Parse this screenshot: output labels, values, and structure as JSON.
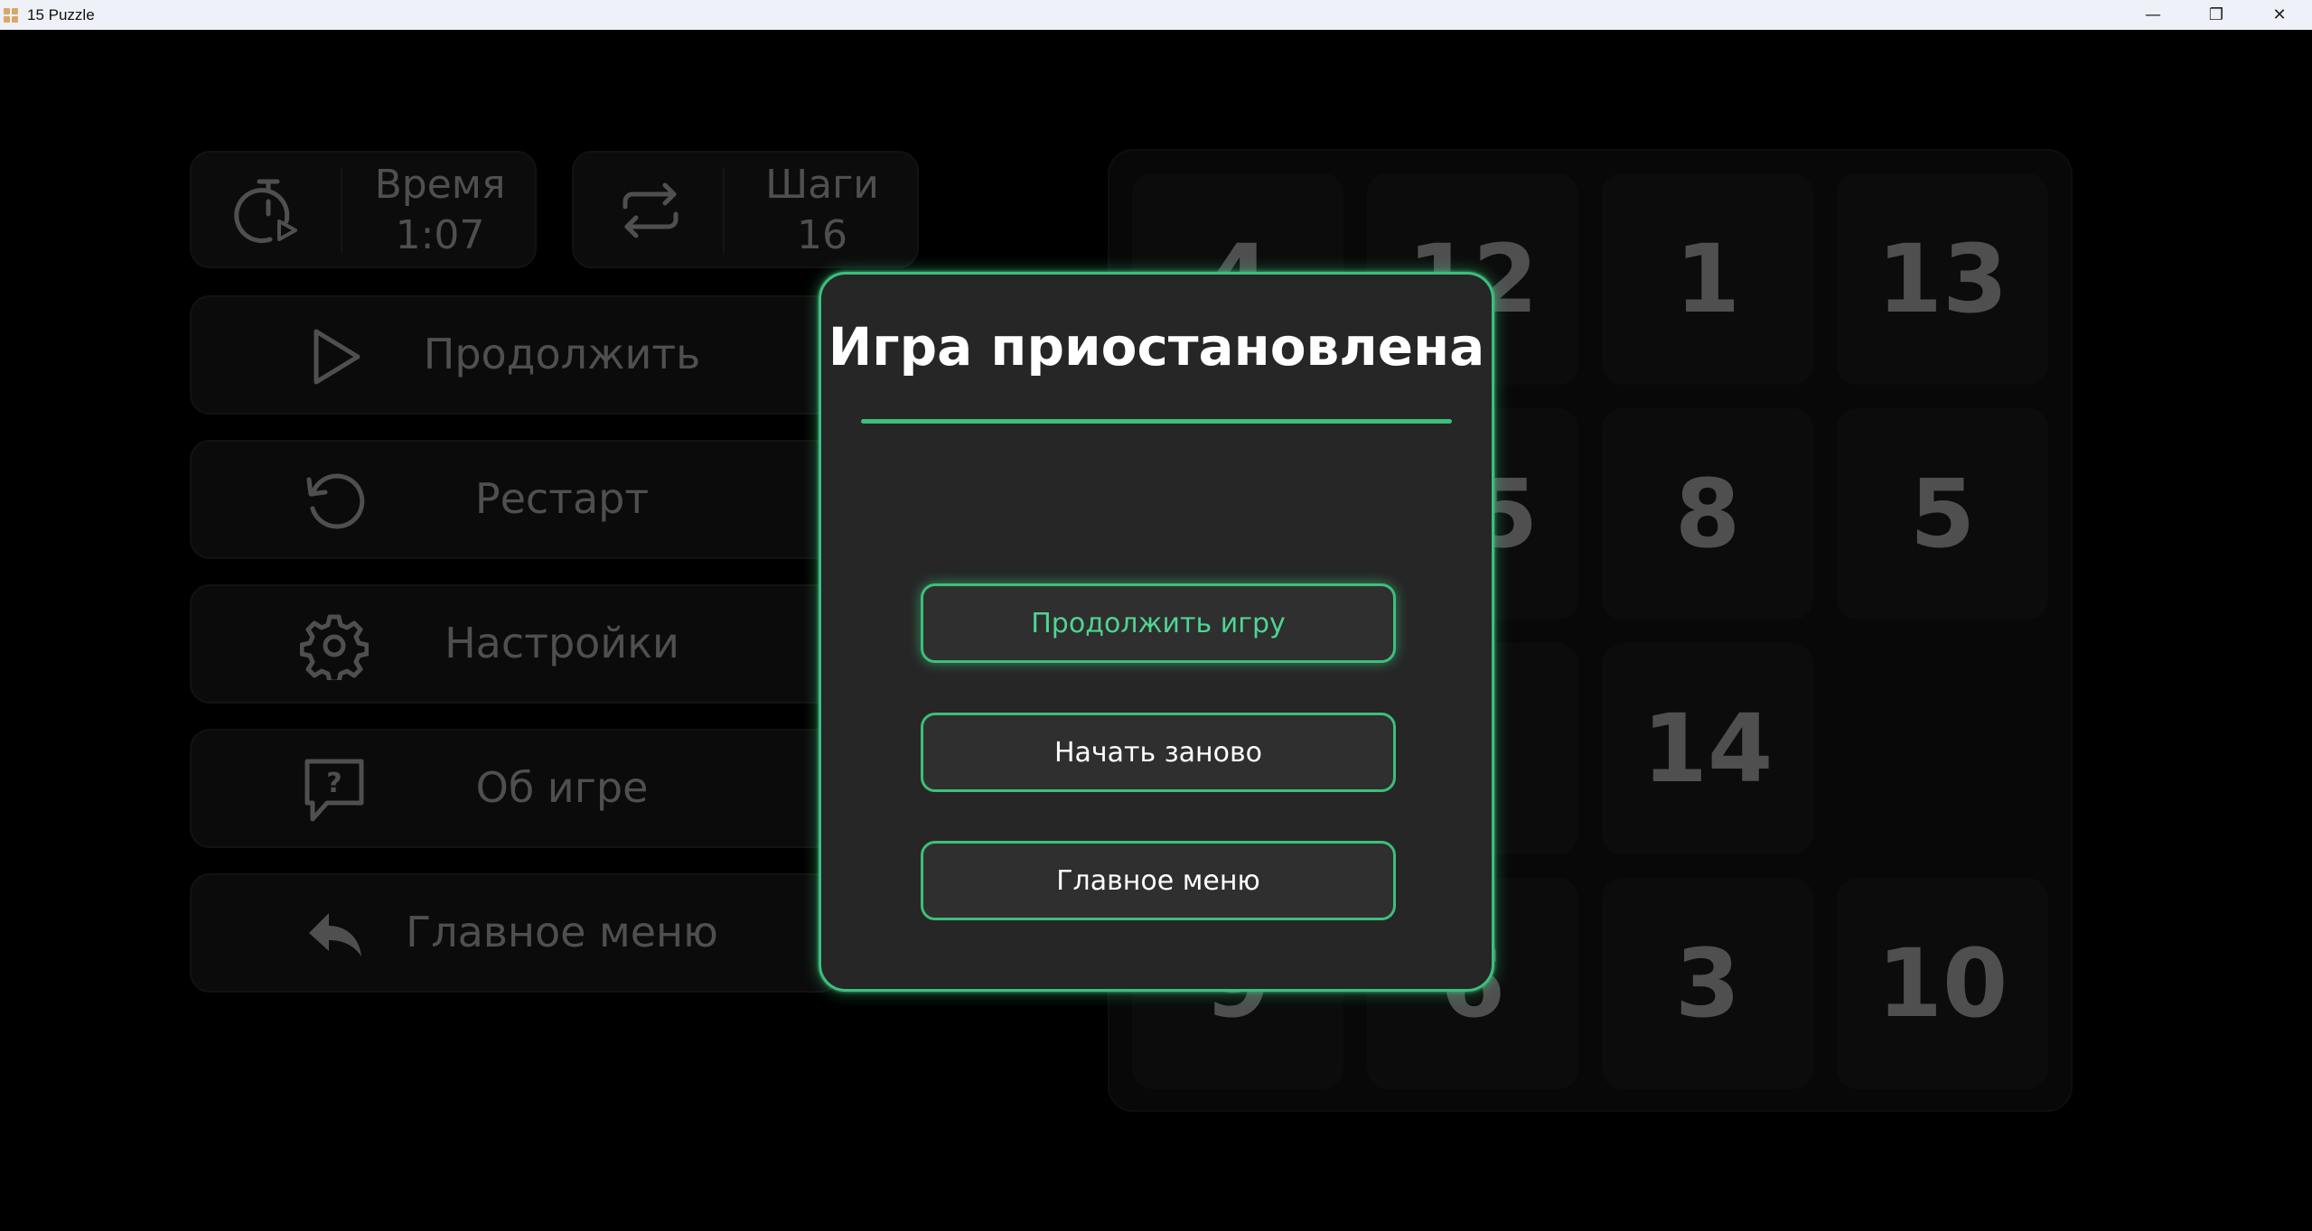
{
  "window": {
    "title": "15 Puzzle",
    "minimize_glyph": "—",
    "maximize_glyph": "❐",
    "close_glyph": "✕"
  },
  "stats": {
    "time_label": "Время",
    "time_value": "1:07",
    "steps_label": "Шаги",
    "steps_value": "16"
  },
  "sidebar": {
    "items": [
      {
        "label": "Продолжить",
        "icon": "play-icon"
      },
      {
        "label": "Рестарт",
        "icon": "restart-icon"
      },
      {
        "label": "Настройки",
        "icon": "gear-icon"
      },
      {
        "label": "Об игре",
        "icon": "help-icon"
      },
      {
        "label": "Главное меню",
        "icon": "back-arrow-icon"
      }
    ]
  },
  "board": {
    "tiles": [
      "4",
      "12",
      "1",
      "13",
      "",
      "15",
      "8",
      "5",
      "",
      "",
      "14",
      "",
      "9",
      "6",
      "3",
      "10"
    ]
  },
  "modal": {
    "title": "Игра приостановлена",
    "buttons": {
      "resume": "Продолжить игру",
      "restart": "Начать заново",
      "main_menu": "Главное меню"
    }
  },
  "colors": {
    "accent": "#3cbf7c",
    "background": "#000000",
    "modal_bg": "#262626"
  }
}
